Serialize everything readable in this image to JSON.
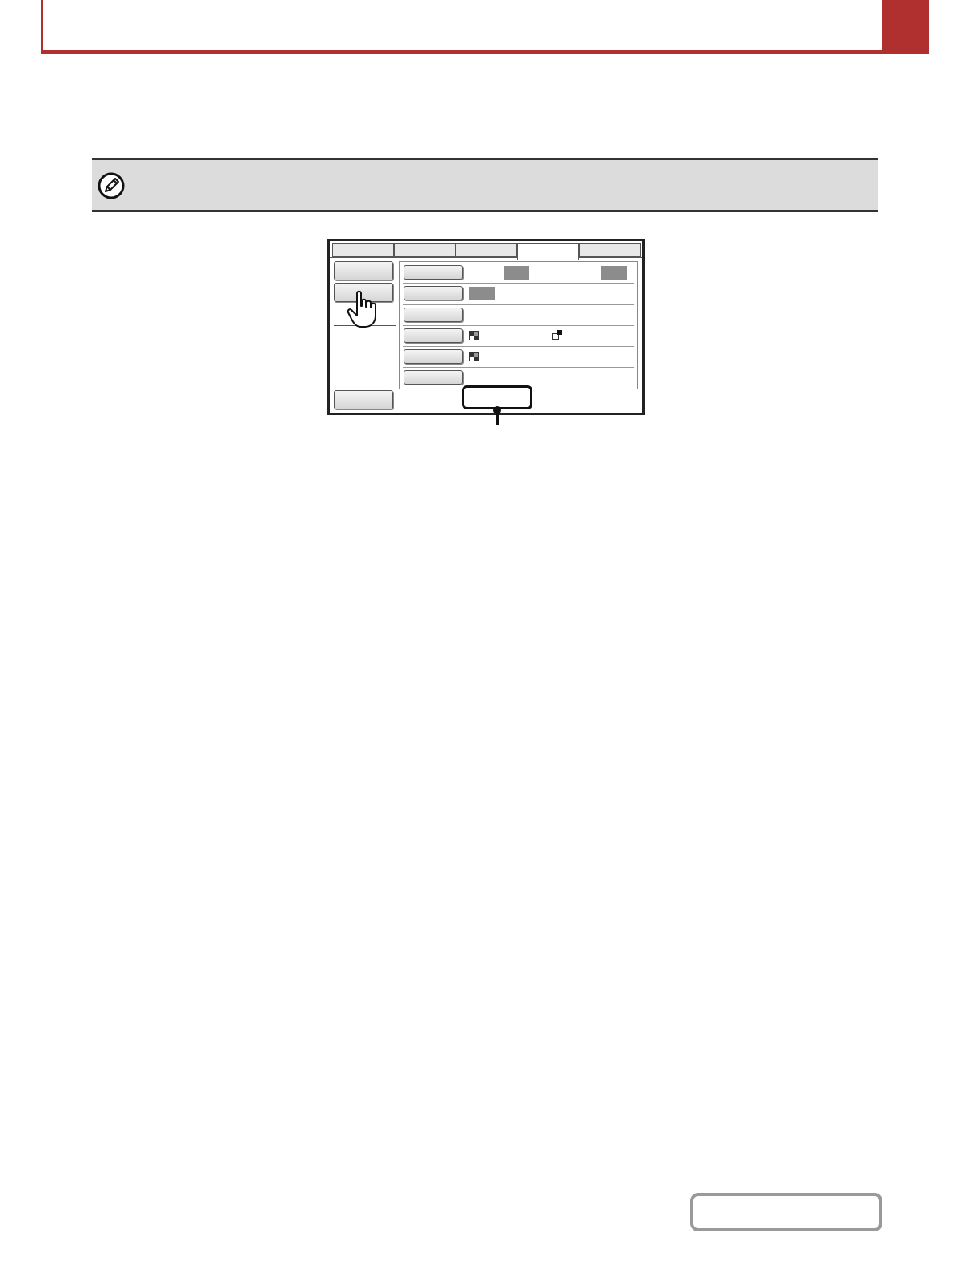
{
  "header": {
    "accent_color": "#b03030"
  },
  "note": {
    "icon": "pencil-icon",
    "bar_color": "#dcdcdc"
  },
  "screen": {
    "tabs": [
      {
        "label": "",
        "active": false
      },
      {
        "label": "",
        "active": false
      },
      {
        "label": "",
        "active": false
      },
      {
        "label": "",
        "active": true
      },
      {
        "label": "",
        "active": false
      }
    ],
    "side_buttons": [
      {
        "label": ""
      },
      {
        "label": ""
      },
      {
        "label": ""
      }
    ],
    "rows": [
      {
        "button_label": ""
      },
      {
        "button_label": ""
      },
      {
        "button_label": ""
      },
      {
        "button_label": ""
      },
      {
        "button_label": ""
      },
      {
        "button_label": ""
      }
    ],
    "pointer_icon": "hand-pointer-icon",
    "callout_icon": "callout-marker"
  },
  "footer": {
    "link_color": "#3355cc"
  }
}
